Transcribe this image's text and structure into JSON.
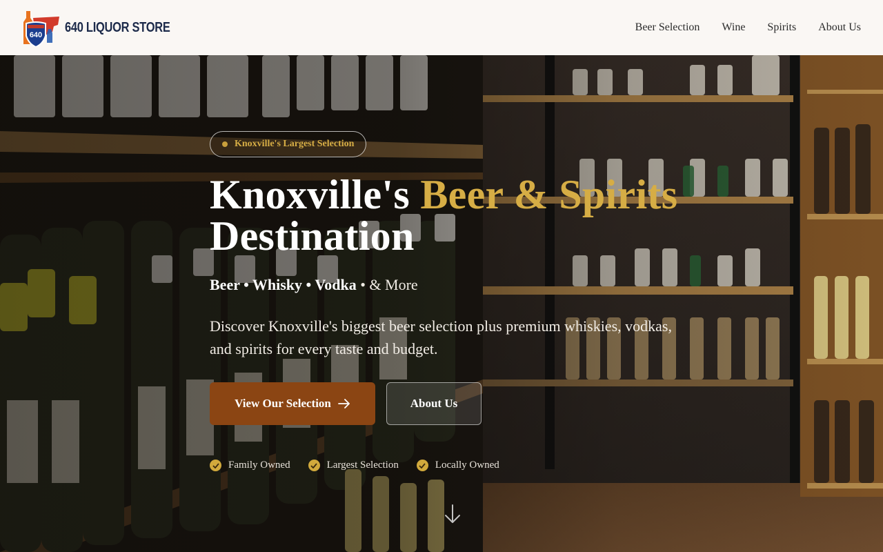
{
  "brand": {
    "name": "640 LIQUOR STORE",
    "shield_number": "640"
  },
  "nav": {
    "items": [
      "Beer Selection",
      "Wine",
      "Spirits",
      "About Us"
    ]
  },
  "hero": {
    "badge": "Knoxville's Largest Selection",
    "title_part1": "Knoxville's ",
    "title_accent": "Beer & Spirits",
    "title_part2": "Destination",
    "subtitle": {
      "item1": "Beer",
      "item2": "Whisky",
      "item3": "Vodka",
      "separator": " • ",
      "more": "& More"
    },
    "description": "Discover Knoxville's biggest beer selection plus premium whiskies, vodkas, and spirits for every taste and budget.",
    "primary_button": "View Our Selection",
    "secondary_button": "About Us",
    "features": [
      "Family Owned",
      "Largest Selection",
      "Locally Owned"
    ]
  },
  "icons": {
    "badge": "dot-icon",
    "primary_button": "arrow-right-icon",
    "features": "check-circle-icon",
    "scroll": "arrow-down-icon"
  },
  "colors": {
    "accent_gold": "#d6ad45",
    "primary_button": "#8b4513",
    "header_bg": "#faf7f4",
    "brand_navy": "#1c2a4a"
  }
}
